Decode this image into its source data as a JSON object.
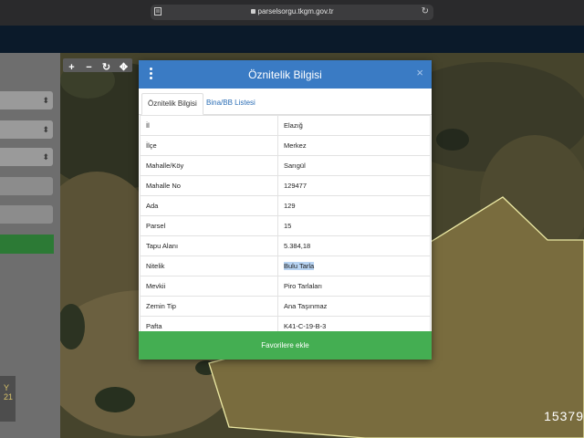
{
  "browser": {
    "url": "parselsorgu.tkgm.gov.tr"
  },
  "map": {
    "scale_text": "15379"
  },
  "left_panel": {
    "thumb_text": "Y 21",
    "accent": "#2c7a35"
  },
  "modal": {
    "title": "Öznitelik Bilgisi",
    "close": "×",
    "tabs": [
      {
        "label": "Öznitelik Bilgisi"
      },
      {
        "label": "Bina/BB Listesi"
      }
    ],
    "rows": [
      {
        "key": "İl",
        "value": "Elazığ"
      },
      {
        "key": "İlçe",
        "value": "Merkez"
      },
      {
        "key": "Mahalle/Köy",
        "value": "Sarıgül"
      },
      {
        "key": "Mahalle No",
        "value": "129477"
      },
      {
        "key": "Ada",
        "value": "129"
      },
      {
        "key": "Parsel",
        "value": "15"
      },
      {
        "key": "Tapu Alanı",
        "value": "5.384,18"
      },
      {
        "key": "Nitelik",
        "value": "Bulu Tarla"
      },
      {
        "key": "Mevkii",
        "value": "Piro Tarlaları"
      },
      {
        "key": "Zemin Tip",
        "value": "Ana Taşınmaz"
      },
      {
        "key": "Pafta",
        "value": "K41-C-19-B-3"
      }
    ],
    "favorite_button": "Favorilere ekle",
    "colors": {
      "header": "#3a7bc4",
      "button": "#44ae52",
      "link": "#2a6db5"
    }
  }
}
